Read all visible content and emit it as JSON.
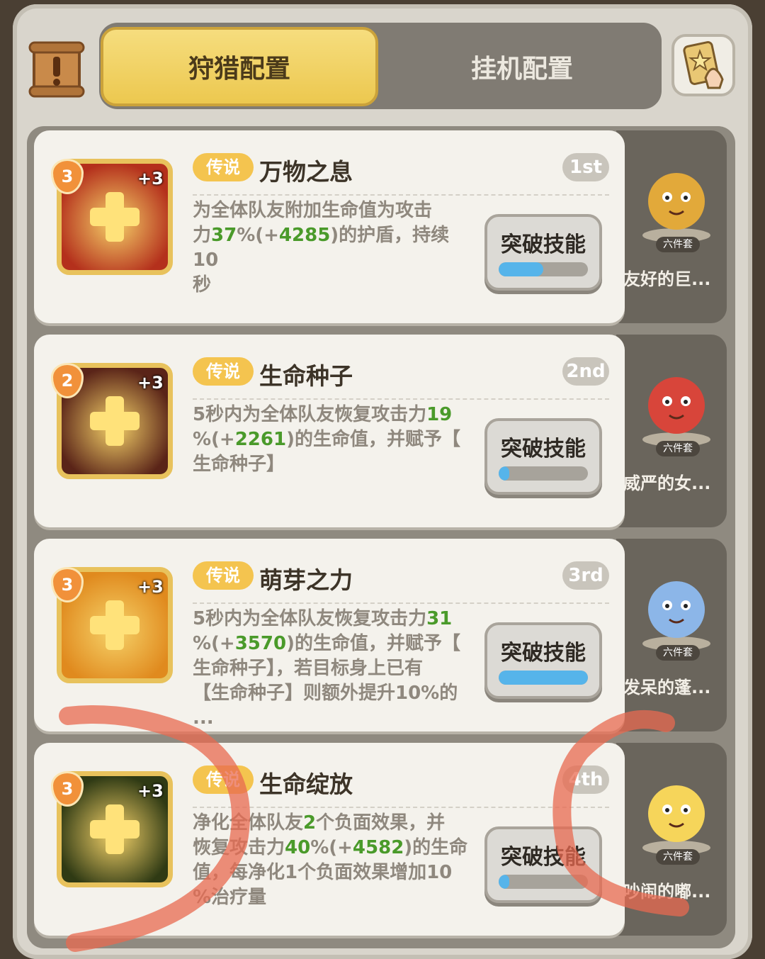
{
  "tabs": [
    {
      "label": "狩猎配置",
      "active": true
    },
    {
      "label": "挂机配置",
      "active": false
    }
  ],
  "header": {
    "scroll_icon": "scroll-icon",
    "tips_icon": "card-hand-icon"
  },
  "skills": [
    {
      "level": "3",
      "plus": "+3",
      "tag": "传说",
      "name": "万物之息",
      "rank": "1st",
      "desc_parts": [
        {
          "t": "为全体队友附加生命值为攻击\n力"
        },
        {
          "t": "37",
          "g": true
        },
        {
          "t": "%(+"
        },
        {
          "t": "4285",
          "g": true
        },
        {
          "t": ")的护盾，持续10\n秒"
        }
      ],
      "button_label": "突破技能",
      "progress": 0.5,
      "side_name": "友好的巨...",
      "set_badge": "六件套",
      "icon_color": "#b4301c"
    },
    {
      "level": "2",
      "plus": "+3",
      "tag": "传说",
      "name": "生命种子",
      "rank": "2nd",
      "desc_parts": [
        {
          "t": "5秒内为全体队友恢复攻击力"
        },
        {
          "t": "19",
          "g": true
        },
        {
          "t": "\n%(+"
        },
        {
          "t": "2261",
          "g": true
        },
        {
          "t": ")的生命值，并赋予【\n生命种子】"
        }
      ],
      "button_label": "突破技能",
      "progress": 0.12,
      "side_name": "威严的女...",
      "set_badge": "六件套",
      "icon_color": "#5a2418"
    },
    {
      "level": "3",
      "plus": "+3",
      "tag": "传说",
      "name": "萌芽之力",
      "rank": "3rd",
      "desc_parts": [
        {
          "t": "5秒内为全体队友恢复攻击力"
        },
        {
          "t": "31",
          "g": true
        },
        {
          "t": "\n%(+"
        },
        {
          "t": "3570",
          "g": true
        },
        {
          "t": ")的生命值，并赋予【\n生命种子】，若目标身上已有\n【生命种子】则额外提升10%的\n..."
        }
      ],
      "button_label": "突破技能",
      "progress": 1.0,
      "side_name": "发呆的蓬...",
      "set_badge": "六件套",
      "icon_color": "#e08a1e"
    },
    {
      "level": "3",
      "plus": "+3",
      "tag": "传说",
      "name": "生命绽放",
      "rank": "4th",
      "desc_parts": [
        {
          "t": "净化全体队友"
        },
        {
          "t": "2",
          "g": true
        },
        {
          "t": "个负面效果，并\n恢复攻击力"
        },
        {
          "t": "40",
          "g": true
        },
        {
          "t": "%(+"
        },
        {
          "t": "4582",
          "g": true
        },
        {
          "t": ")的生命\n值，每净化1个负面效果增加10\n%治疗量"
        }
      ],
      "button_label": "突破技能",
      "progress": 0.1,
      "side_name": "吵闹的嘟...",
      "set_badge": "六件套",
      "icon_color": "#2f3a14"
    }
  ]
}
